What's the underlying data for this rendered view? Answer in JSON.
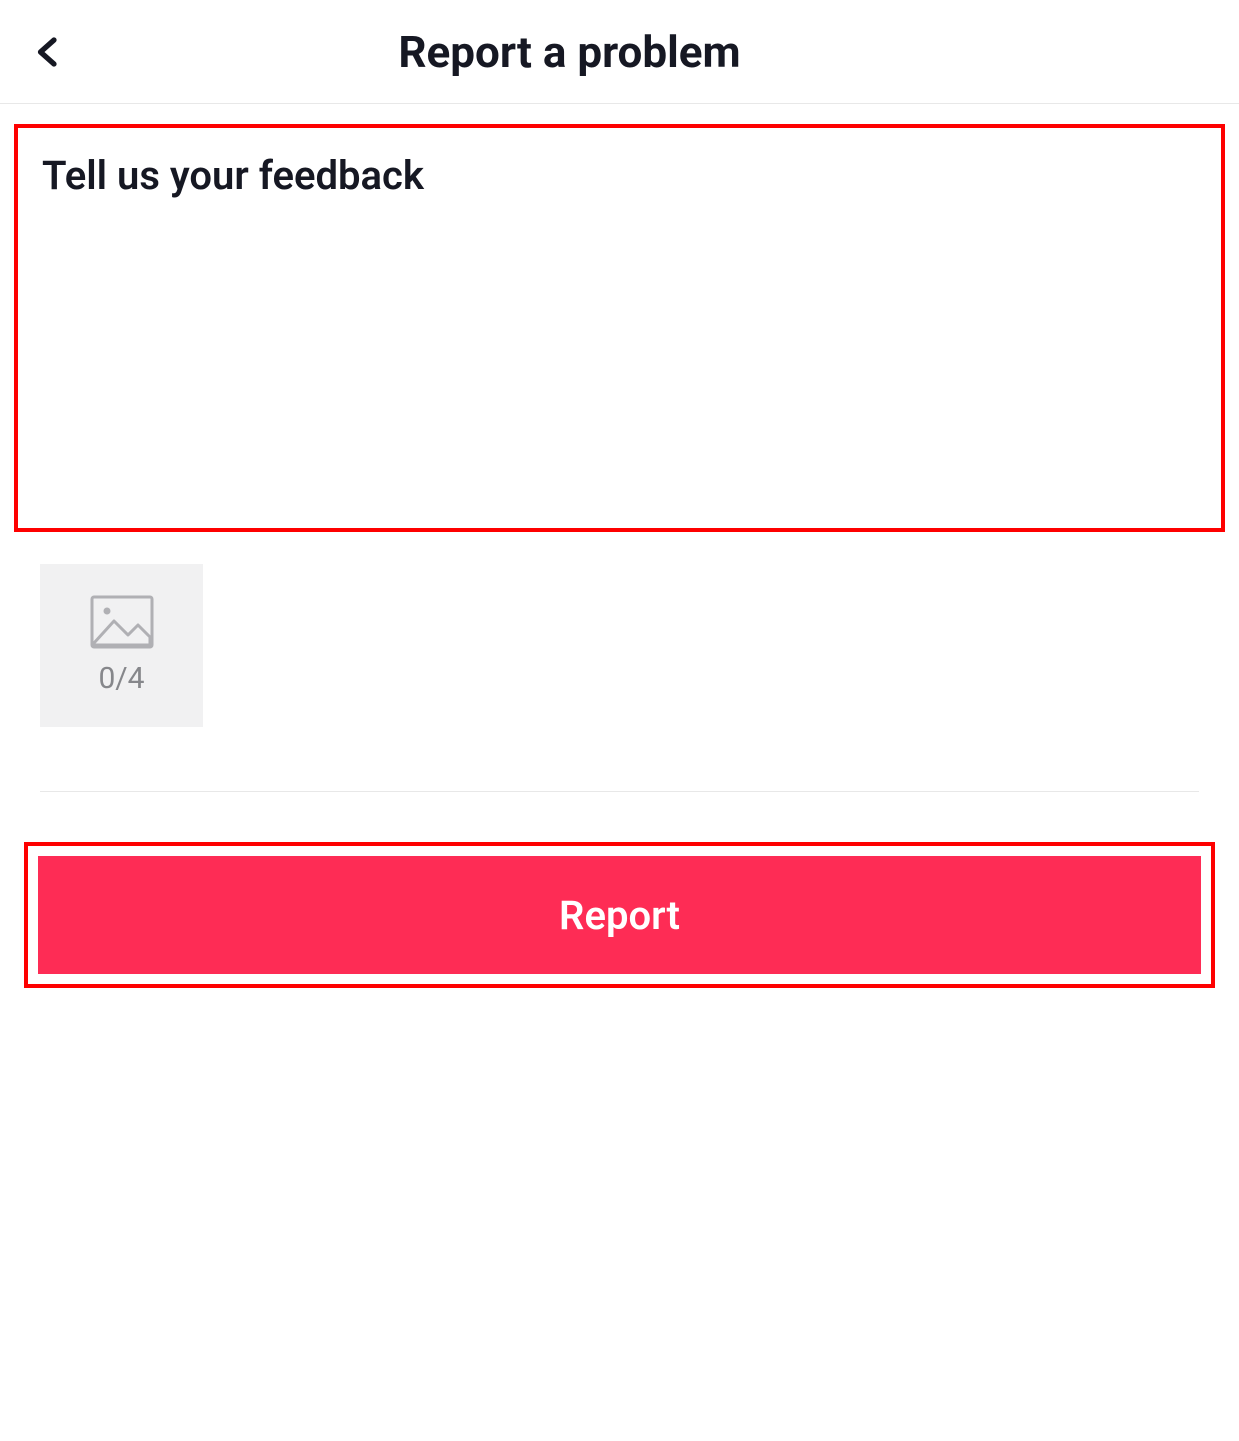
{
  "header": {
    "title": "Report a problem"
  },
  "feedback": {
    "placeholder": "Tell us your feedback",
    "value": ""
  },
  "upload": {
    "current": 0,
    "max": 4,
    "counter": "0/4"
  },
  "actions": {
    "report_label": "Report"
  },
  "colors": {
    "highlight": "#fe0000",
    "primary": "#fe2c55"
  }
}
